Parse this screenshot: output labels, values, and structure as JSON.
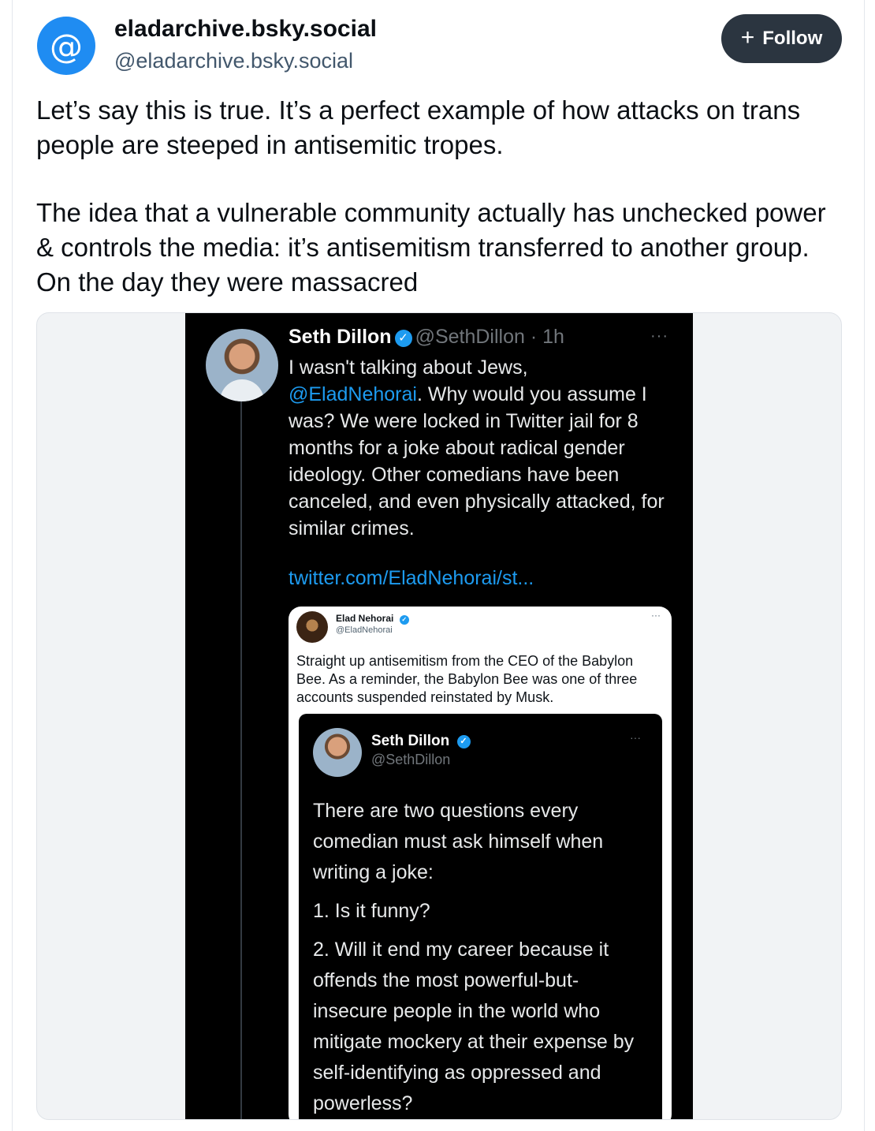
{
  "post": {
    "avatar_glyph": "@",
    "display_name": "eladarchive.bsky.social",
    "handle": "@eladarchive.bsky.social",
    "follow_label": "Follow",
    "follow_icon": "plus-icon",
    "paragraph_1": "Let’s say this is true. It’s a perfect example of how attacks on trans people are steeped in antisemitic tropes.",
    "paragraph_2": "The idea that a vulnerable community actually has unchecked power & controls the media: it’s antisemitism transferred to another group. On the day they were massacred"
  },
  "embedded_tweet": {
    "name": "Seth Dillon",
    "meta": "@SethDillon · 1h",
    "more": "···",
    "text_before_mention": "I wasn't talking about Jews,",
    "mention": "@EladNehorai",
    "text_after_mention": ". Why would you assume I was? We were locked in Twitter jail for 8 months for a joke about radical gender ideology. Other comedians have been canceled, and even physically attacked, for similar crimes.",
    "link": "twitter.com/EladNehorai/st...",
    "quote": {
      "name": "Elad Nehorai",
      "handle": "@EladNehorai",
      "more": "···",
      "text": "Straight up antisemitism from the CEO of the Babylon Bee. As a reminder, the Babylon Bee was one of three accounts suspended reinstated by Musk.",
      "inner": {
        "name": "Seth Dillon",
        "handle": "@SethDillon",
        "more": "···",
        "line_1": "There are two questions every comedian must ask himself when writing a joke:",
        "line_2": "1. Is it funny?",
        "line_3": "2. Will it end my career because it offends the most powerful-but-insecure people in the world who mitigate mockery at their expense by self-identifying as oppressed and powerless?"
      }
    }
  },
  "colors": {
    "accent": "#1d9bf0",
    "avatar_blue": "#1f8cf2",
    "follow_button_bg": "#2b3540"
  }
}
